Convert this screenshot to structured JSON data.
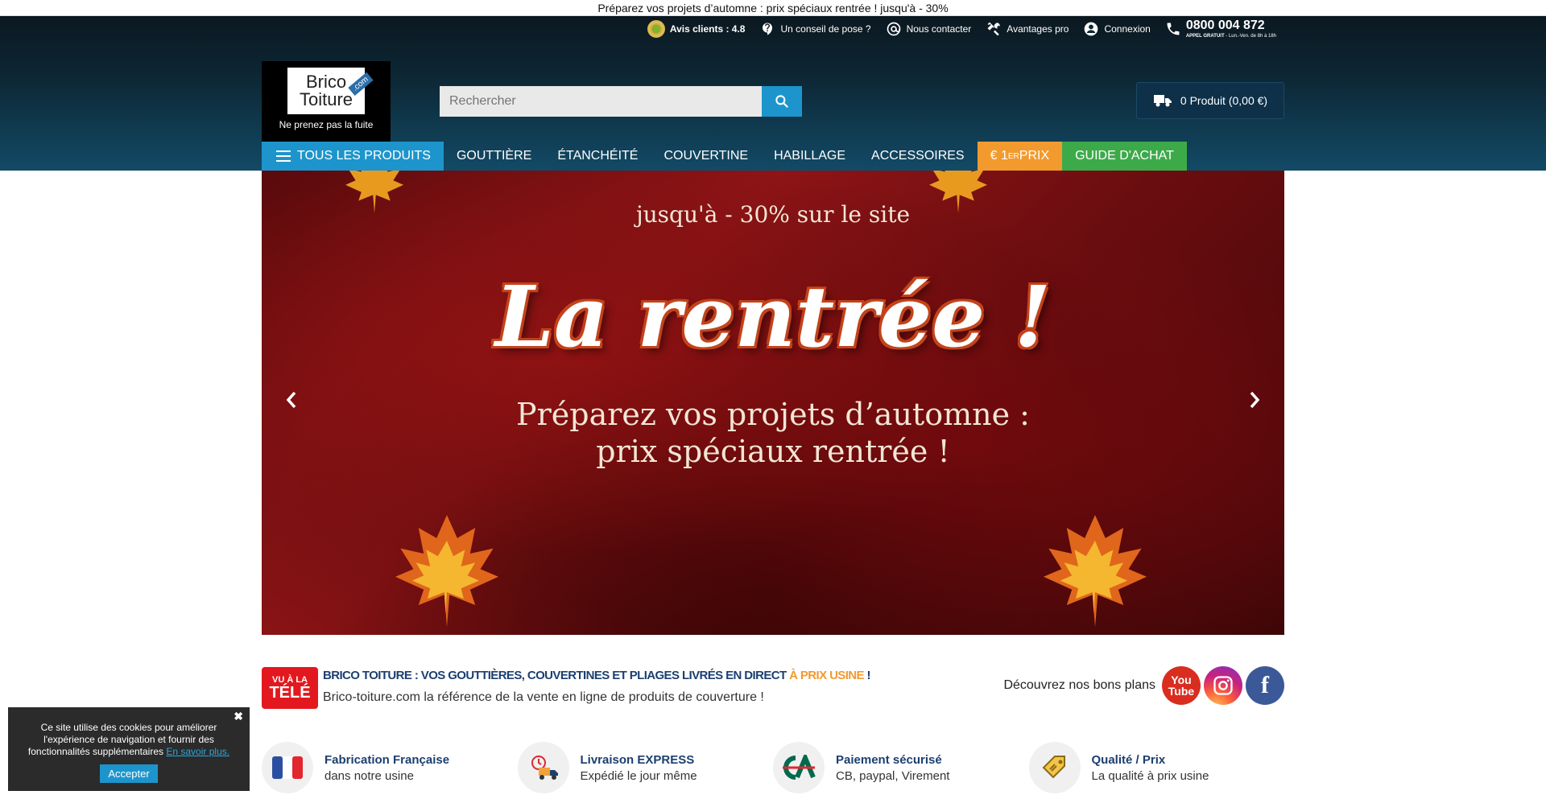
{
  "promo": {
    "text": "Préparez vos projets d’automne : prix spéciaux rentrée ! jusqu'à - 30%"
  },
  "topnav": {
    "avis": "Avis clients : 4.8",
    "conseil": "Un conseil de pose ?",
    "contact": "Nous contacter",
    "pro": "Avantages pro",
    "login": "Connexion",
    "phone": "0800 004 872",
    "phone_sub_bold": "APPEL GRATUIT",
    "phone_sub": " - Lun.-Ven. de 8h à 18h"
  },
  "logo": {
    "line1": "Brico",
    "line2": "Toiture",
    "tag": ".com",
    "slogan": "Ne prenez pas la fuite"
  },
  "search": {
    "placeholder": "Rechercher"
  },
  "cart": {
    "label": "0 Produit (0,00 €)"
  },
  "nav": {
    "all": "TOUS LES PRODUITS",
    "items": [
      "GOUTTIÈRE",
      "ÉTANCHÉITÉ",
      "COUVERTINE",
      "HABILLAGE",
      "ACCESSOIRES"
    ],
    "prix_prefix": "€ 1",
    "prix_sup": "ER",
    "prix_suffix": " PRIX",
    "guide": "GUIDE D'ACHAT"
  },
  "hero": {
    "top": "jusqu'à - 30% sur le site",
    "big": "La rentrée !",
    "sub1": "Préparez vos projets d’automne :",
    "sub2": "prix spéciaux rentrée !"
  },
  "tv": {
    "logo1": "VU À LA",
    "logo2": "TÉLÉ",
    "headline": "BRICO TOITURE : VOS GOUTTIÈRES, COUVERTINES ET PLIAGES LIVRÉS EN DIRECT ",
    "headline_orange": "À PRIX USINE",
    "headline_end": " !",
    "desc": "Brico-toiture.com la référence de la vente en ligne de produits de couverture !"
  },
  "social": {
    "label": "Découvrez nos bons plans",
    "yt1": "You",
    "yt2": "Tube",
    "fb": "f"
  },
  "features": [
    {
      "title": "Fabrication Française",
      "sub": "dans notre usine"
    },
    {
      "title": "Livraison EXPRESS",
      "sub": "Expédié le jour même"
    },
    {
      "title": "Paiement sécurisé",
      "sub": "CB, paypal, Virement"
    },
    {
      "title": "Qualité / Prix",
      "sub": "La qualité à prix usine"
    }
  ],
  "cookie": {
    "text": "Ce site utilise des cookies pour améliorer l'expérience de navigation et fournir des fonctionnalités supplémentaires",
    "link": "En savoir plus.",
    "button": "Accepter",
    "close": "✖"
  }
}
